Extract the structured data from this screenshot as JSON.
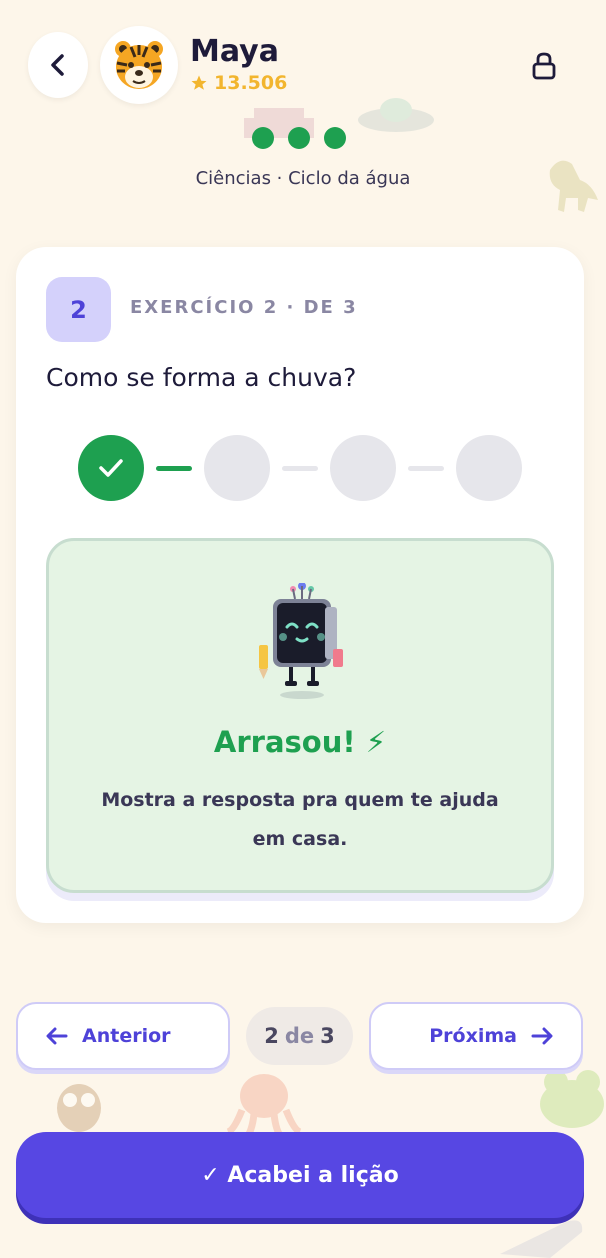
{
  "header": {
    "user_name": "Maya",
    "points": "13.506",
    "avatar_emoji": "🐯",
    "avatar_icon": "tiger-icon",
    "subtitle": "Ciências · Ciclo da água"
  },
  "progress_dots": 3,
  "exercise": {
    "number": "2",
    "label": "EXERCÍCIO 2 · DE 3",
    "question": "Como se forma a chuva?",
    "steps_total": 4,
    "steps_completed": 1
  },
  "result": {
    "title": "Arrasou! ⚡",
    "message": "Mostra a resposta pra quem te ajuda em casa."
  },
  "navigation": {
    "prev_label": "Anterior",
    "next_label": "Próxima",
    "current": "2",
    "of": "de",
    "total": "3"
  },
  "finish_button": "✓ Acabei a lição",
  "colors": {
    "background": "#FDF6EA",
    "accent": "#5747E3",
    "success": "#1EA050",
    "points": "#F2B52E"
  }
}
